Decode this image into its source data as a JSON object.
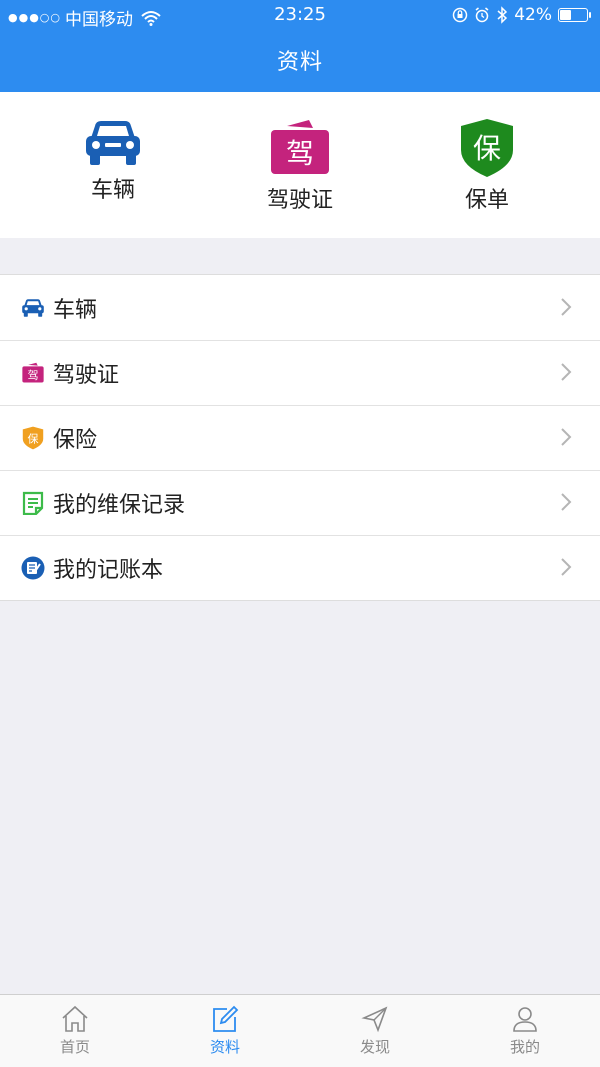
{
  "status_bar": {
    "carrier": "中国移动",
    "time": "23:25",
    "battery": "42%",
    "battery_level": 0.42
  },
  "header": {
    "title": "资料"
  },
  "quick_actions": [
    {
      "label": "车辆",
      "icon": "car-icon",
      "color": "#1a5fb4"
    },
    {
      "label": "驾驶证",
      "icon": "license-icon",
      "icon_text": "驾",
      "color": "#c4237d"
    },
    {
      "label": "保单",
      "icon": "shield-icon",
      "icon_text": "保",
      "color": "#1e8a1e"
    }
  ],
  "menu": [
    {
      "label": "车辆",
      "icon": "car-icon",
      "color": "#1a5fb4"
    },
    {
      "label": "驾驶证",
      "icon": "license-icon",
      "icon_text": "驾",
      "color": "#c4237d"
    },
    {
      "label": "保险",
      "icon": "shield-icon",
      "icon_text": "保",
      "color": "#f0a020"
    },
    {
      "label": "我的维保记录",
      "icon": "maintenance-record-icon",
      "color": "#3dbb4a"
    },
    {
      "label": "我的记账本",
      "icon": "account-book-icon",
      "color": "#1a5fb4"
    }
  ],
  "tabbar": [
    {
      "label": "首页",
      "icon": "home-icon",
      "active": false
    },
    {
      "label": "资料",
      "icon": "edit-icon",
      "active": true
    },
    {
      "label": "发现",
      "icon": "send-icon",
      "active": false
    },
    {
      "label": "我的",
      "icon": "user-icon",
      "active": false
    }
  ],
  "colors": {
    "accent": "#2d8cf0",
    "background": "#efeff4"
  }
}
